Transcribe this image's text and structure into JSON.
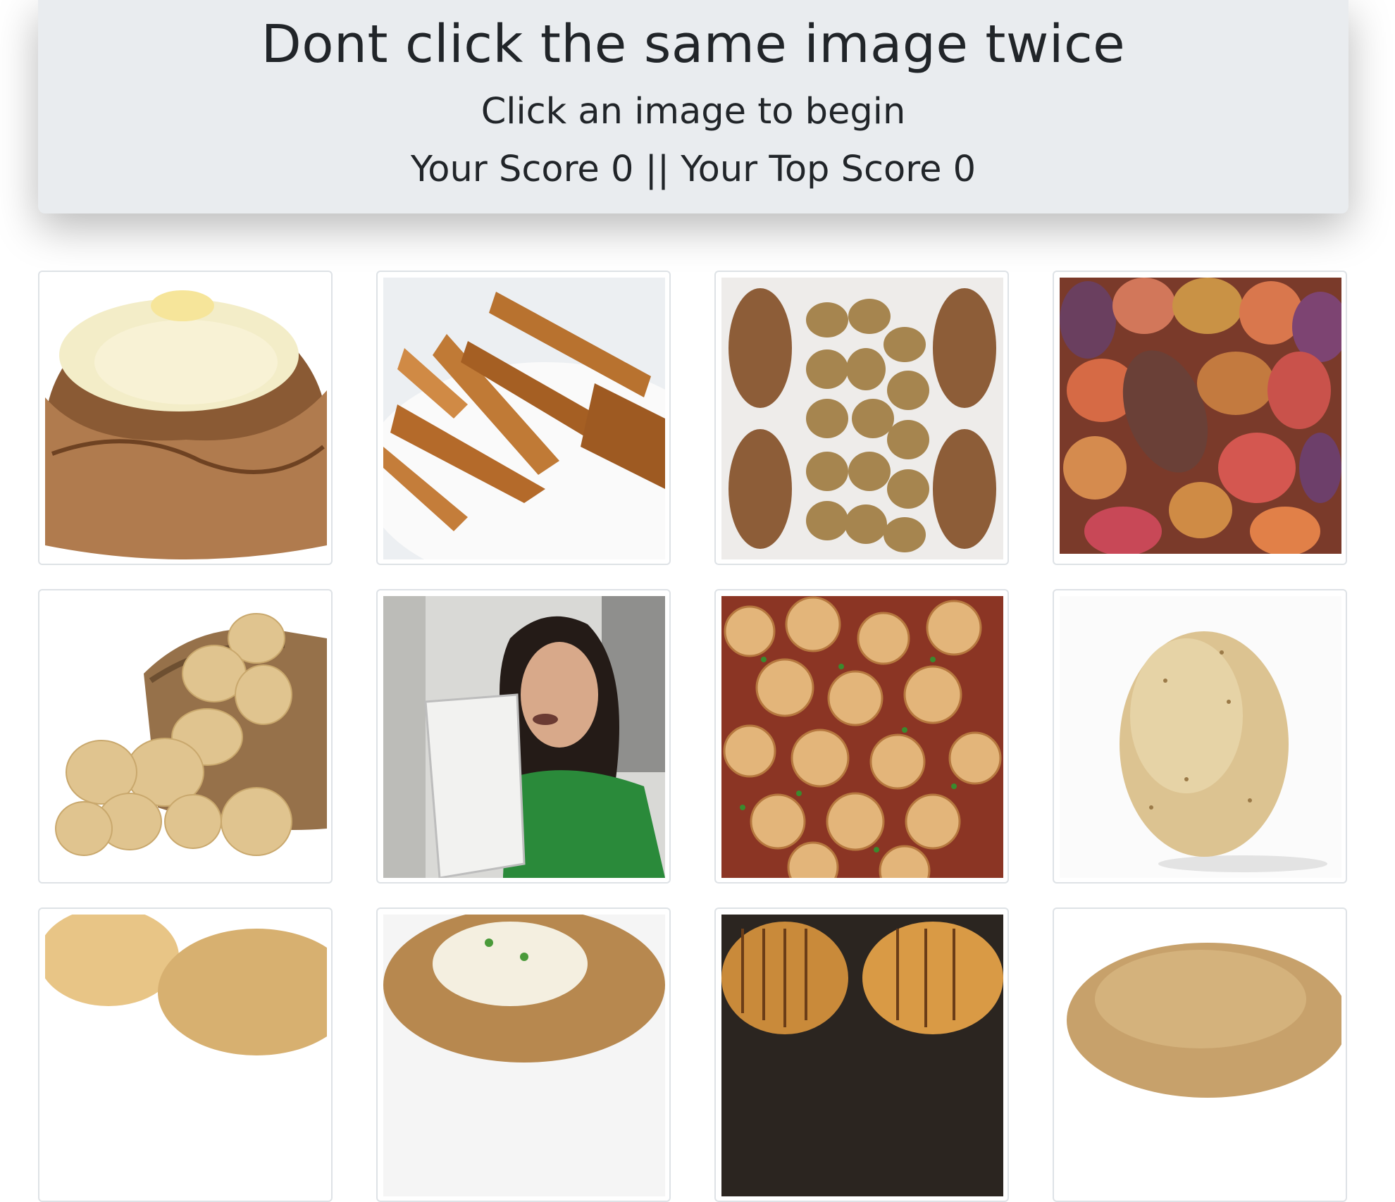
{
  "header": {
    "title": "Dont click the same image twice",
    "subtitle": "Click an image to begin",
    "score_text": "Your Score 0 || Your Top Score 0"
  },
  "score": {
    "current": 0,
    "top": 0
  },
  "images": [
    {
      "name": "baked-potato-image"
    },
    {
      "name": "potato-wedges-image"
    },
    {
      "name": "potato-arrangement-image"
    },
    {
      "name": "mixed-potatoes-image"
    },
    {
      "name": "potato-sack-image"
    },
    {
      "name": "person-photo-image"
    },
    {
      "name": "roasted-potatoes-bacon-image"
    },
    {
      "name": "single-potato-image"
    },
    {
      "name": "halved-potatoes-image"
    },
    {
      "name": "loaded-baked-potato-image"
    },
    {
      "name": "hasselback-potatoes-image"
    },
    {
      "name": "potato-closeup-image"
    }
  ],
  "colors": {
    "jumbotron_bg": "#e9ecef",
    "text": "#212529",
    "card_border": "#dee2e6"
  }
}
